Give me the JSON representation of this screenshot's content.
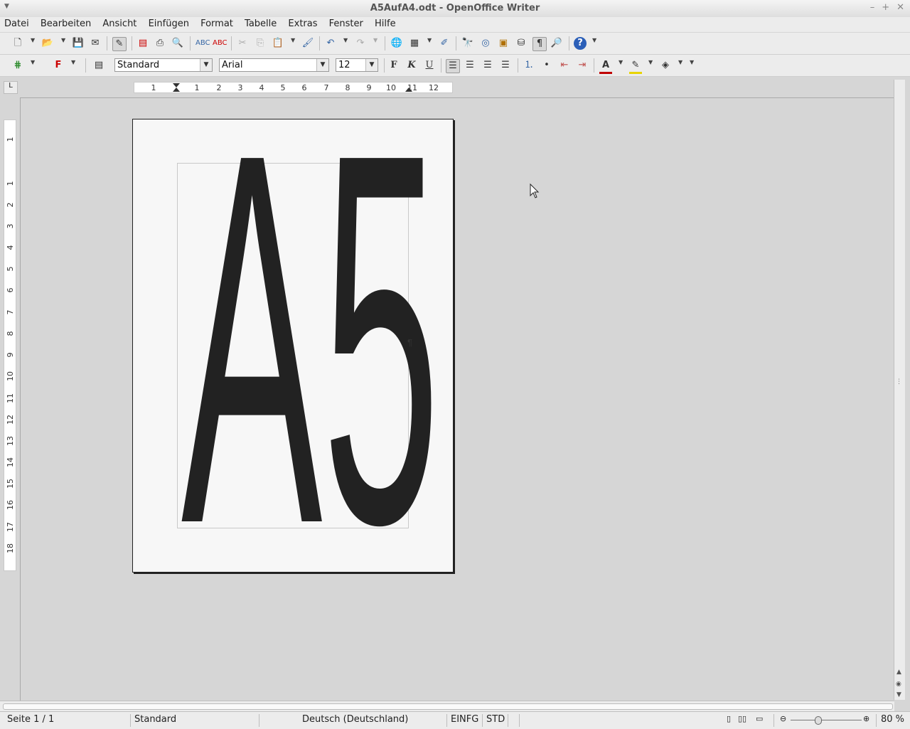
{
  "window": {
    "title": "A5AufA4.odt - OpenOffice Writer"
  },
  "menu": [
    "Datei",
    "Bearbeiten",
    "Ansicht",
    "Einfügen",
    "Format",
    "Tabelle",
    "Extras",
    "Fenster",
    "Hilfe"
  ],
  "format_toolbar": {
    "style": "Standard",
    "font": "Arial",
    "size": "12",
    "bold": "F",
    "italic": "K",
    "underline": "U"
  },
  "document": {
    "text": "A5",
    "pilcrow": "¶"
  },
  "ruler": {
    "h_labels": [
      "1",
      "1",
      "2",
      "3",
      "4",
      "5",
      "6",
      "7",
      "8",
      "9",
      "10",
      "11",
      "12"
    ],
    "v_labels": [
      "1",
      "1",
      "2",
      "3",
      "4",
      "5",
      "6",
      "7",
      "8",
      "9",
      "10",
      "11",
      "12",
      "13",
      "14",
      "15",
      "16",
      "17",
      "18"
    ]
  },
  "status": {
    "page": "Seite 1 / 1",
    "style": "Standard",
    "language": "Deutsch (Deutschland)",
    "insert_mode": "EINFG",
    "selection_mode": "STD",
    "zoom": "80 %"
  },
  "colors": {
    "font_color": "#c00000",
    "highlight": "#e8d400",
    "accent": "#3465a4"
  },
  "icons": [
    "new-icon",
    "open-icon",
    "save-icon",
    "email-icon",
    "edit-mode-icon",
    "pdf-icon",
    "print-icon",
    "print-preview-icon",
    "spellcheck-icon",
    "autospell-icon",
    "cut-icon",
    "copy-icon",
    "paste-icon",
    "format-paintbrush-icon",
    "undo-icon",
    "redo-icon",
    "hyperlink-icon",
    "table-icon",
    "draw-icon",
    "find-icon",
    "navigator-icon",
    "gallery-icon",
    "datasource-icon",
    "nonprinting-chars-icon",
    "zoom-icon",
    "help-icon"
  ]
}
